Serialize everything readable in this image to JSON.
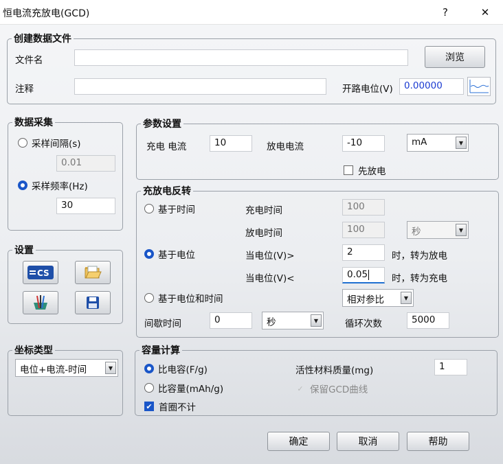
{
  "window": {
    "title": "恒电流充放电(GCD)",
    "help_glyph": "?",
    "close_glyph": "✕"
  },
  "file_group": {
    "legend": "创建数据文件",
    "filename_label": "文件名",
    "filename_value": "",
    "browse_label": "浏览",
    "comment_label": "注释",
    "comment_value": "",
    "ocp_label": "开路电位(V)",
    "ocp_value": "0.00000"
  },
  "sampling": {
    "legend": "数据采集",
    "interval_label": "采样间隔(s)",
    "interval_value": "0.01",
    "freq_label": "采样频率(Hz)",
    "freq_value": "30",
    "selected": "freq"
  },
  "params": {
    "legend": "参数设置",
    "charge_current_label": "充电 电流",
    "charge_current_value": "10",
    "discharge_current_label": "放电电流",
    "discharge_current_value": "-10",
    "unit_value": "mA",
    "discharge_first_label": "先放电",
    "discharge_first_checked": false
  },
  "settings": {
    "legend": "设置"
  },
  "reversal": {
    "legend": "充放电反转",
    "by_time_label": "基于时间",
    "charge_time_label": "充电时间",
    "charge_time_value": "100",
    "discharge_time_label": "放电时间",
    "discharge_time_value": "100",
    "time_unit_value": "秒",
    "by_potential_label": "基于电位",
    "gt_label": "当电位(V)>",
    "gt_value": "2",
    "gt_action": "时，转为放电",
    "lt_label": "当电位(V)<",
    "lt_value": "0.05",
    "lt_action": "时，转为充电",
    "by_both_label": "基于电位和时间",
    "ref_value": "相对参比",
    "rest_label": "间歇时间",
    "rest_value": "0",
    "rest_unit_value": "秒",
    "cycles_label": "循环次数",
    "cycles_value": "5000",
    "selected": "potential"
  },
  "axis": {
    "legend": "坐标类型",
    "value": "电位+电流-时间"
  },
  "capacity": {
    "legend": "容量计算",
    "specific_cap_label": "比电容(F/g)",
    "specific_capacity_label": "比容量(mAh/g)",
    "skip_first_label": "首圈不计",
    "skip_first_checked": true,
    "mass_label": "活性材料质量(mg)",
    "mass_value": "1",
    "keep_curve_label": "保留GCD曲线",
    "selected": "specific_cap"
  },
  "footer": {
    "ok_label": "确定",
    "cancel_label": "取消",
    "help_label": "帮助"
  },
  "colors": {
    "accent": "#1a56c8",
    "value_blue": "#1a3ad1"
  }
}
